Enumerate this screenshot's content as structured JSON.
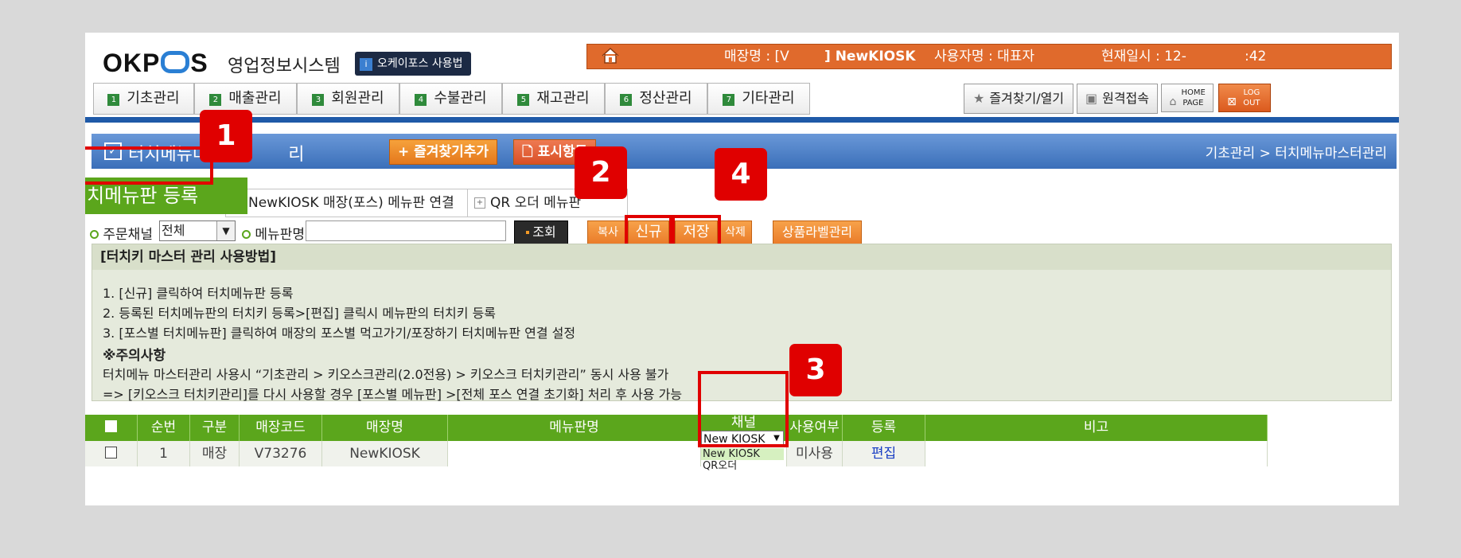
{
  "header": {
    "logo_text": "OKPOS",
    "system_name": "영업정보시스템",
    "guide_badge": "오케이포스 사용법",
    "guide_num": "i",
    "store_label": "매장명 : [V",
    "store_name": "] NewKIOSK",
    "user_label": "사용자명 : 대표자",
    "datetime_label": "현재일시 : 12-",
    "datetime_tail": ":42"
  },
  "menu_tabs": [
    {
      "num": "1",
      "label": "기초관리"
    },
    {
      "num": "2",
      "label": "매출관리"
    },
    {
      "num": "3",
      "label": "회원관리"
    },
    {
      "num": "4",
      "label": "수불관리"
    },
    {
      "num": "5",
      "label": "재고관리"
    },
    {
      "num": "6",
      "label": "정산관리"
    },
    {
      "num": "7",
      "label": "기타관리"
    }
  ],
  "right_buttons": {
    "favorites": "즐겨찾기/열기",
    "remote": "원격접속",
    "home": "HOME PAGE",
    "logout": "LOG OUT"
  },
  "title_bar": {
    "title": "터치메뉴마스터관리",
    "title_visible": "터치메뉴마",
    "title_visible_tail": "리",
    "add_favorite": "즐겨찾기추가",
    "display_items": "표시항목",
    "breadcrumb": "기초관리 > 터치메뉴마스터관리"
  },
  "sub_tabs": {
    "active": "터치메뉴판 등록",
    "tab2": "NewKIOSK 매장(포스) 메뉴판 연결",
    "tab3": "QR 오더 메뉴판"
  },
  "filters": {
    "channel_label": "주문채널",
    "channel_value": "전체",
    "menu_label": "메뉴판명",
    "menu_value": "",
    "search_button": "조회"
  },
  "action_buttons": {
    "left_partial": "복사",
    "new": "신규",
    "save": "저장",
    "delete_partial": "삭제",
    "label_mgmt": "상품라벨관리"
  },
  "instructions": {
    "heading": "[터치키 마스터 관리 사용방법]",
    "lines": [
      "1. [신규] 클릭하여 터치메뉴판 등록",
      "2. 등록된 터치메뉴판의 터치키 등록>[편집] 클릭시 메뉴판의 터치키 등록",
      "3. [포스별 터치메뉴판] 클릭하여 매장의 포스별 먹고가기/포장하기 터치메뉴판 연결 설정"
    ],
    "note_heading": "※주의사항",
    "notes": [
      "터치메뉴 마스터관리 사용시 “기초관리 > 키오스크관리(2.0전용) > 키오스크 터치키관리” 동시 사용 불가",
      "=> [키오스크 터치키관리]를 다시 사용할 경우 [포스별 메뉴판] >[전체 포스 연결 초기화] 처리 후 사용 가능"
    ]
  },
  "table": {
    "headers": [
      "",
      "순번",
      "구분",
      "매장코드",
      "매장명",
      "메뉴판명",
      "채널",
      "사용여부",
      "등록",
      "비고"
    ],
    "rows": [
      {
        "seq": "1",
        "type": "매장",
        "code": "V73276",
        "store": "NewKIOSK",
        "menu": "",
        "channel": "New KIOSK",
        "use": "미사용",
        "edit": "편집",
        "note": ""
      }
    ],
    "channel_options": [
      "New KIOSK",
      "QR오더"
    ]
  },
  "callouts": [
    "1",
    "2",
    "3",
    "4"
  ],
  "colors": {
    "accent_green": "#5ba61c",
    "info_orange": "#e06a2c",
    "title_blue": "#3a6fb9",
    "callout_red": "#e00000"
  }
}
